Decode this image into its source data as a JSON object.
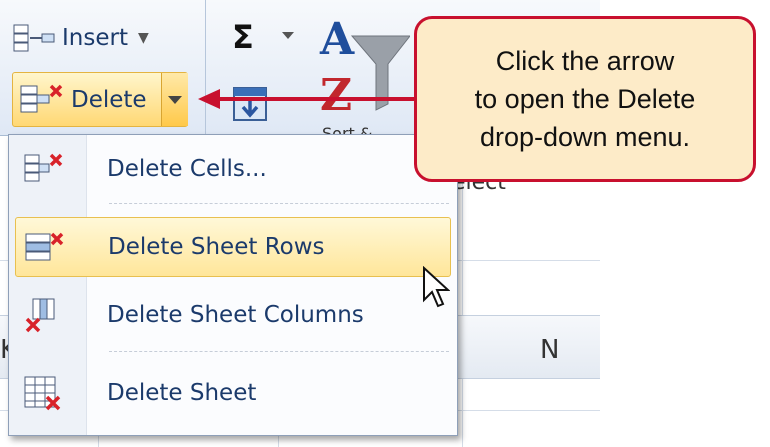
{
  "ribbon": {
    "insert_label": "Insert",
    "delete_label": "Delete",
    "sort_label_partial": "Sort &",
    "hidden_text": "elect"
  },
  "menu": {
    "items": [
      {
        "label": "Delete Cells...",
        "icon": "delete-cells-icon"
      },
      {
        "label": "Delete Sheet Rows",
        "icon": "delete-rows-icon",
        "highlighted": true
      },
      {
        "label": "Delete Sheet Columns",
        "icon": "delete-columns-icon"
      },
      {
        "label": "Delete Sheet",
        "icon": "delete-sheet-icon"
      }
    ]
  },
  "callout": {
    "line1": "Click the arrow",
    "line2": "to open the Delete",
    "line3": "drop-down menu."
  },
  "columns": {
    "n": "N",
    "k": "K"
  },
  "colors": {
    "accent_red": "#c8102e",
    "callout_fill": "#fdebc8",
    "highlight": "#ffe69a",
    "menu_text": "#1b3a6b"
  }
}
